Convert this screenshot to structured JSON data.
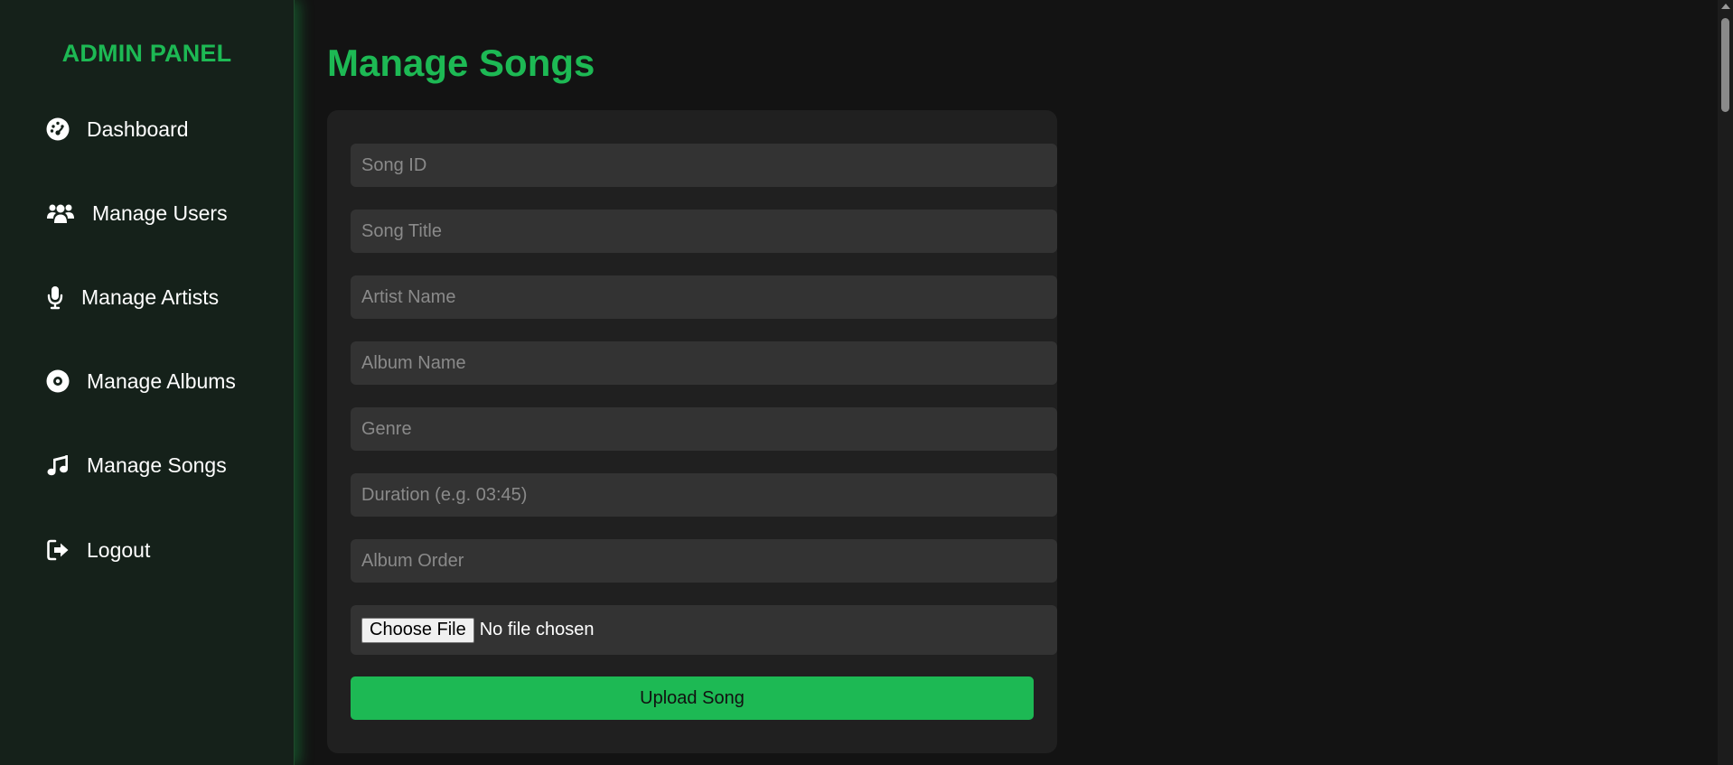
{
  "sidebar": {
    "brand": "ADMIN PANEL",
    "items": [
      {
        "label": "Dashboard",
        "icon": "dashboard-gauge-icon"
      },
      {
        "label": "Manage Users",
        "icon": "users-icon"
      },
      {
        "label": "Manage Artists",
        "icon": "microphone-icon"
      },
      {
        "label": "Manage Albums",
        "icon": "album-disc-icon"
      },
      {
        "label": "Manage Songs",
        "icon": "music-note-icon"
      },
      {
        "label": "Logout",
        "icon": "logout-icon"
      }
    ]
  },
  "main": {
    "title": "Manage Songs",
    "form": {
      "fields": [
        {
          "placeholder": "Song ID",
          "value": ""
        },
        {
          "placeholder": "Song Title",
          "value": ""
        },
        {
          "placeholder": "Artist Name",
          "value": ""
        },
        {
          "placeholder": "Album Name",
          "value": ""
        },
        {
          "placeholder": "Genre",
          "value": ""
        },
        {
          "placeholder": "Duration (e.g. 03:45)",
          "value": ""
        },
        {
          "placeholder": "Album Order",
          "value": ""
        }
      ],
      "file_button": "Choose File",
      "file_status": "No file chosen",
      "submit": "Upload Song"
    }
  },
  "colors": {
    "accent": "#1db954",
    "background": "#131313",
    "sidebar": "#15211a",
    "card": "#202020",
    "input": "#333333"
  }
}
